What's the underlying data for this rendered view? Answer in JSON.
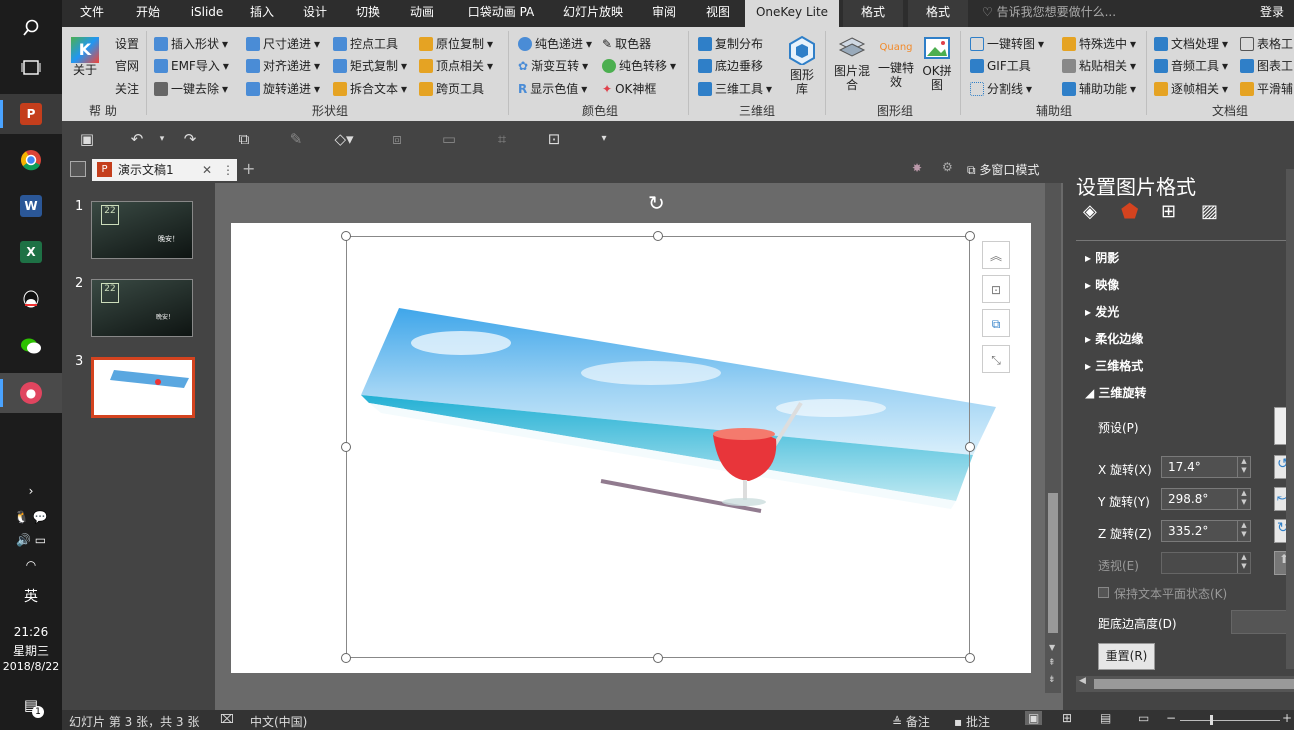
{
  "taskbar": {
    "tray_ime": "英",
    "time": "21:26",
    "weekday": "星期三",
    "date": "2018/8/22",
    "notif_count": "1"
  },
  "tabs": [
    "文件",
    "开始",
    "iSlide",
    "插入",
    "设计",
    "切换",
    "动画",
    "口袋动画 PA",
    "幻灯片放映",
    "审阅",
    "视图",
    "OneKey Lite",
    "格式",
    "格式"
  ],
  "tell_me": "告诉我您想要做什么...",
  "login": "登录",
  "ribbon": {
    "help": {
      "about": "关于",
      "settings": "设置",
      "website": "官网",
      "follow": "关注",
      "group": "帮 助"
    },
    "shape": {
      "items": [
        "插入形状",
        "尺寸递进",
        "控点工具",
        "原位复制",
        "EMF导入",
        "对齐递进",
        "矩式复制",
        "顶点相关",
        "一键去除",
        "旋转递进",
        "拆合文本",
        "跨页工具"
      ],
      "group": "形状组"
    },
    "color": {
      "items": [
        "纯色递进",
        "取色器",
        "渐变互转",
        "纯色转移",
        "显示色值",
        "OK神框"
      ],
      "group": "颜色组"
    },
    "threed": {
      "items": [
        "复制分布",
        "底边垂移",
        "三维工具"
      ],
      "big": "图形库",
      "group": "三维组"
    },
    "image": {
      "mix": "图片混合",
      "effect": "一键特效",
      "jigsaw": "OK拼图",
      "group": "图形组"
    },
    "aux": {
      "items": [
        "一键转图",
        "特殊选中",
        "GIF工具",
        "粘贴相关",
        "分割线",
        "辅助功能"
      ],
      "group": "辅助组"
    },
    "docs": {
      "items": [
        "文档处理",
        "表格工",
        "音频工具",
        "图表工",
        "逐帧相关",
        "平滑辅"
      ],
      "group": "文档组"
    }
  },
  "doc": {
    "tab": "演示文稿1",
    "multiwin": "多窗口模式"
  },
  "slides": [
    "1",
    "2",
    "3"
  ],
  "thumb_text": {
    "s1": "晚安！",
    "s2": "晚安！"
  },
  "pane": {
    "title": "设置图片格式",
    "sections": [
      "阴影",
      "映像",
      "发光",
      "柔化边缘",
      "三维格式",
      "三维旋转"
    ],
    "preset": "预设(P)",
    "x_label": "X 旋转(X)",
    "x_value": "17.4°",
    "y_label": "Y 旋转(Y)",
    "y_value": "298.8°",
    "z_label": "Z 旋转(Z)",
    "z_value": "335.2°",
    "persp_label": "透视(E)",
    "keep_text": "保持文本平面状态(K)",
    "distance": "距底边高度(D)",
    "reset": "重置(R)"
  },
  "status": {
    "slide": "幻灯片 第 3 张，共 3 张",
    "lang": "中文(中国)",
    "notes": "备注",
    "comments": "批注"
  },
  "colors": {
    "accent": "#c43e1c",
    "ribbon": "#d9d9d9",
    "dark": "#444444"
  }
}
